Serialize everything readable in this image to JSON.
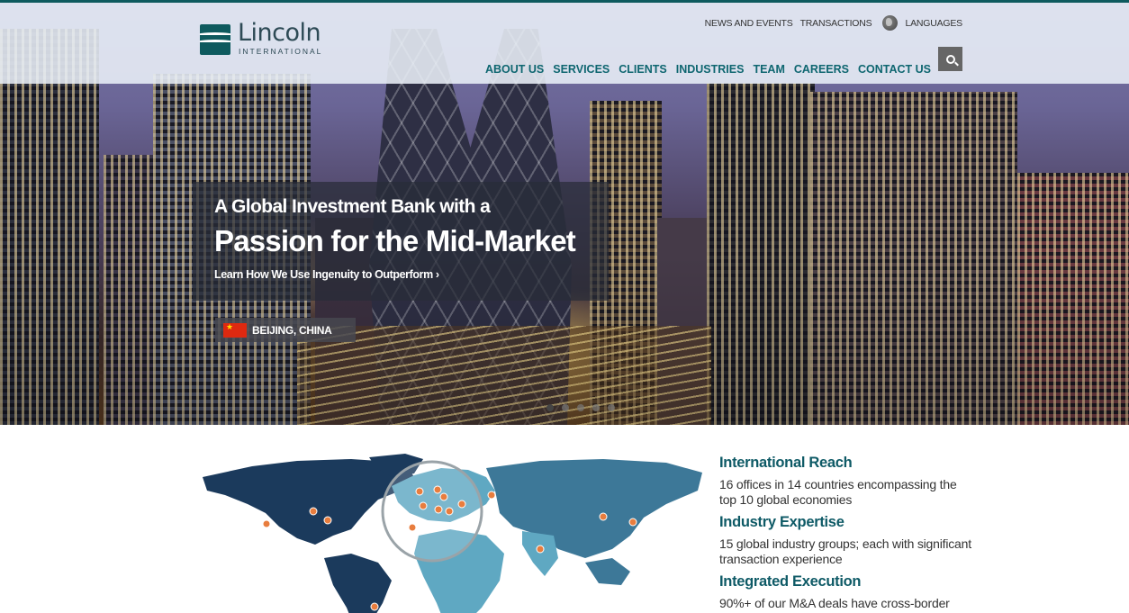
{
  "brand": {
    "name": "Lincoln",
    "subtitle": "INTERNATIONAL",
    "color": "#0e5a5e"
  },
  "utility_nav": {
    "news": "NEWS AND EVENTS",
    "transactions": "TRANSACTIONS",
    "languages": "LANGUAGES"
  },
  "main_nav": {
    "items": [
      "ABOUT US",
      "SERVICES",
      "CLIENTS",
      "INDUSTRIES",
      "TEAM",
      "CAREERS",
      "CONTACT US"
    ],
    "color": "#0e6670"
  },
  "hero": {
    "line1": "A Global Investment Bank with a",
    "line2": "Passion for the Mid-Market",
    "link": "Learn How We Use Ingenuity to Outperform ›",
    "location": "BEIJING, CHINA",
    "slides_total": 5,
    "slide_active": 1
  },
  "features": [
    {
      "title": "International Reach",
      "text": "16 offices in 14 countries encompassing the top 10 global economies"
    },
    {
      "title": "Industry Expertise",
      "text": "15 global industry groups; each with significant transaction experience"
    },
    {
      "title": "Integrated Execution",
      "text": "90%+ of our M&A deals have cross-border"
    }
  ],
  "map_colors": {
    "americas": "#1b3a5c",
    "europe_africa": "#5fa8c2",
    "asia": "#3d7898",
    "pin": "#e87d3e"
  }
}
